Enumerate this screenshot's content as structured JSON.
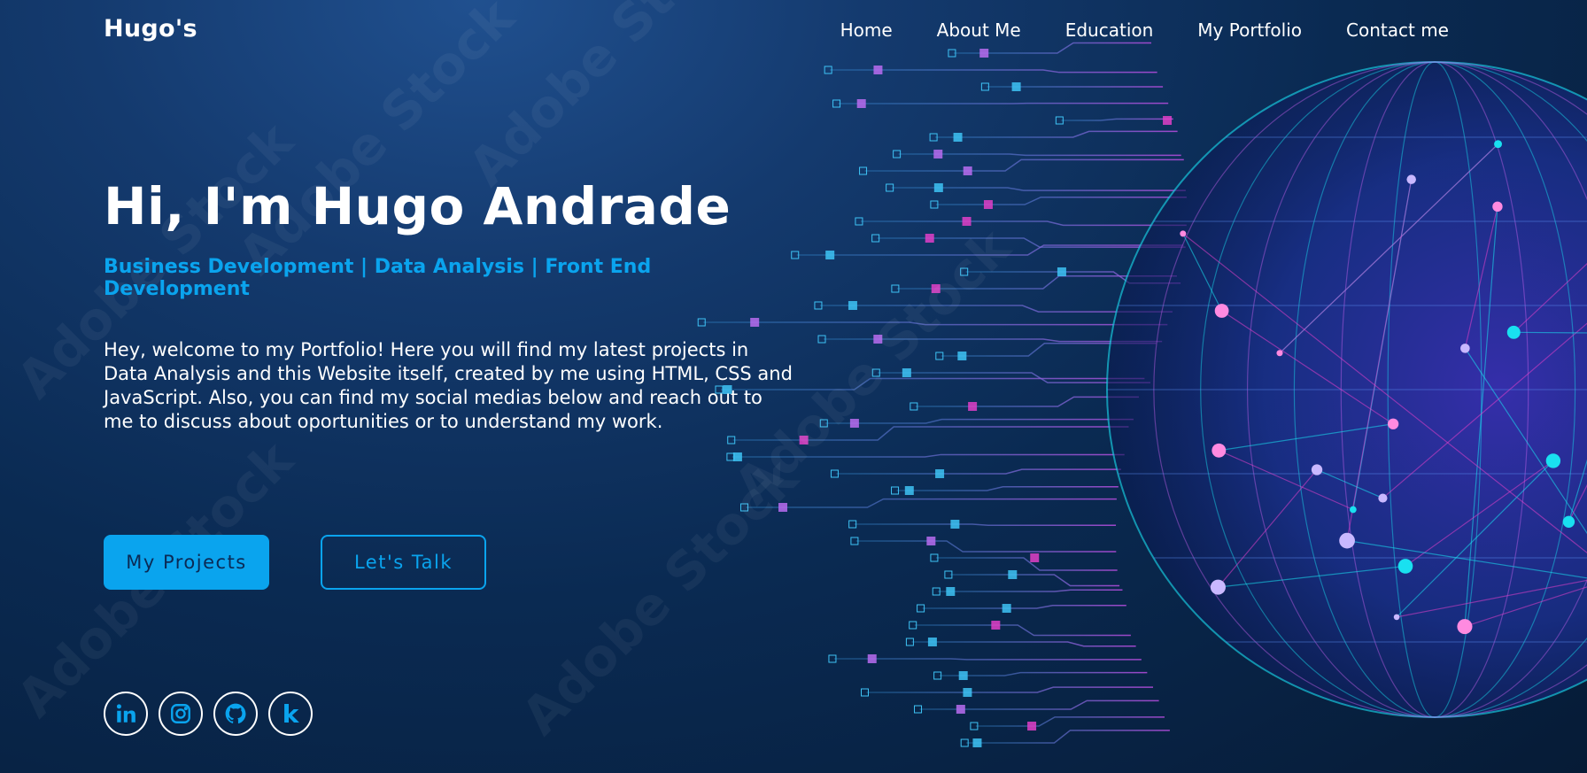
{
  "header": {
    "logo": "Hugo's",
    "nav": [
      {
        "label": "Home"
      },
      {
        "label": "About Me"
      },
      {
        "label": "Education"
      },
      {
        "label": "My Portfolio"
      },
      {
        "label": "Contact me"
      }
    ]
  },
  "hero": {
    "title": "Hi, I'm Hugo Andrade",
    "subtitle": "Business Development | Data Analysis | Front End Development",
    "intro": "Hey, welcome to my Portfolio! Here you will find my latest projects in Data Analysis and this Website itself, created by me using HTML, CSS and JavaScript. Also, you can find my social medias below and reach out to me to discuss about oportunities or to understand my work."
  },
  "buttons": {
    "primary_label": "My Projects",
    "secondary_label": "Let's Talk"
  },
  "socials": [
    {
      "icon": "linkedin-icon"
    },
    {
      "icon": "instagram-icon"
    },
    {
      "icon": "github-icon"
    },
    {
      "icon": "kaggle-icon",
      "glyph": "k"
    }
  ],
  "watermark": "Adobe Stock",
  "colors": {
    "accent": "#0aa4ee",
    "background": "#0a2a52",
    "text": "#ffffff",
    "globe_cyan": "#19e0f0",
    "globe_pink": "#e040c8"
  }
}
